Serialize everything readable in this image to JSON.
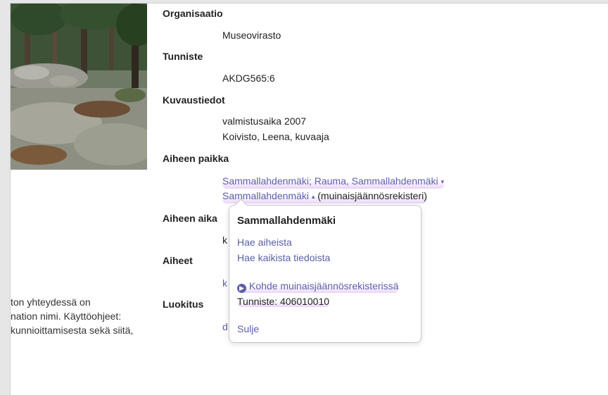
{
  "left_text": {
    "lines": [
      "ton yhteydessä on",
      "nation nimi. Käyttöohjeet:",
      "kunnioittamisesta sekä siitä,"
    ]
  },
  "fields": {
    "organisaatio": {
      "label": "Organisaatio",
      "value": "Museovirasto"
    },
    "tunniste": {
      "label": "Tunniste",
      "value": "AKDG565:6"
    },
    "kuvaustiedot": {
      "label": "Kuvaustiedot",
      "lines": [
        "valmistusaika 2007",
        "Koivisto, Leena, kuvaaja"
      ]
    },
    "aiheen_paikka": {
      "label": "Aiheen paikka",
      "link1": "Sammallahdenmäki; Rauma, Sammallahdenmäki",
      "link2": "Sammallahdenmäki",
      "suffix": "(muinaisjäännösrekisteri)"
    },
    "aiheen_aika": {
      "label": "Aiheen aika",
      "value_partial": "k"
    },
    "aiheet": {
      "label": "Aiheet",
      "value_partial": "k"
    },
    "luokitus": {
      "label": "Luokitus",
      "value_partial": "d"
    }
  },
  "popover": {
    "title": "Sammallahdenmäki",
    "search_topics": "Hae aiheista",
    "search_all": "Hae kaikista tiedoista",
    "registry_link": "Kohde muinaisjäännösrekisterissä",
    "identifier": "Tunniste: 406010010",
    "close": "Sulje"
  },
  "icons": {
    "caret_down": "caret-down-icon",
    "caret_up": "caret-up-icon",
    "arrow_circle": "chevron-circle-right-icon"
  },
  "colors": {
    "link": "#5b5fa8",
    "highlight": "#e6cdf8"
  }
}
